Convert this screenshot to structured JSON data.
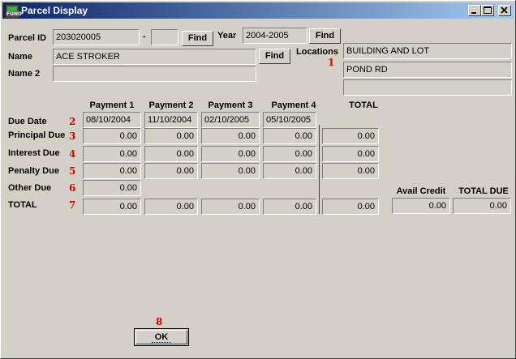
{
  "window": {
    "title": "Parcel Display",
    "icon_label": "FUND"
  },
  "titlebar_buttons": {
    "minimize": "minimize-icon",
    "maximize": "maximize-icon",
    "close": "close-icon"
  },
  "form": {
    "parcel_id_label": "Parcel ID",
    "parcel_id": "203020005",
    "parcel_sep": "-",
    "parcel_suffix": "",
    "find_label": "Find",
    "year_label": "Year",
    "year": "2004-2005",
    "name_label": "Name",
    "name": "ACE STROKER",
    "name2_label": "Name 2",
    "name2": "",
    "locations_label": "Locations",
    "locations": [
      "BUILDING AND LOT",
      "POND RD",
      ""
    ]
  },
  "columns": [
    "Payment 1",
    "Payment 2",
    "Payment 3",
    "Payment 4",
    "TOTAL"
  ],
  "rows": [
    {
      "label": "Due Date",
      "marker": "2",
      "values": [
        "08/10/2004",
        "11/10/2004",
        "02/10/2005",
        "05/10/2005"
      ]
    },
    {
      "label": "Principal Due",
      "marker": "3",
      "values": [
        "0.00",
        "0.00",
        "0.00",
        "0.00",
        "0.00"
      ]
    },
    {
      "label": "Interest Due",
      "marker": "4",
      "values": [
        "0.00",
        "0.00",
        "0.00",
        "0.00",
        "0.00"
      ]
    },
    {
      "label": "Penalty Due",
      "marker": "5",
      "values": [
        "0.00",
        "0.00",
        "0.00",
        "0.00",
        "0.00"
      ]
    },
    {
      "label": "Other Due",
      "marker": "6",
      "values": [
        "0.00"
      ]
    },
    {
      "label": "TOTAL",
      "marker": "7",
      "values": [
        "0.00",
        "0.00",
        "0.00",
        "0.00",
        "0.00"
      ]
    }
  ],
  "credit": {
    "avail_label": "Avail Credit",
    "avail": "0.00",
    "total_due_label": "TOTAL DUE",
    "total_due": "0.00"
  },
  "markers": {
    "locations": "1",
    "ok": "8"
  },
  "ok_label": "OK",
  "colors": {
    "title_start": "#0a246a",
    "title_end": "#a6caf0",
    "face": "#d4d0c8",
    "marker": "#e00000"
  }
}
